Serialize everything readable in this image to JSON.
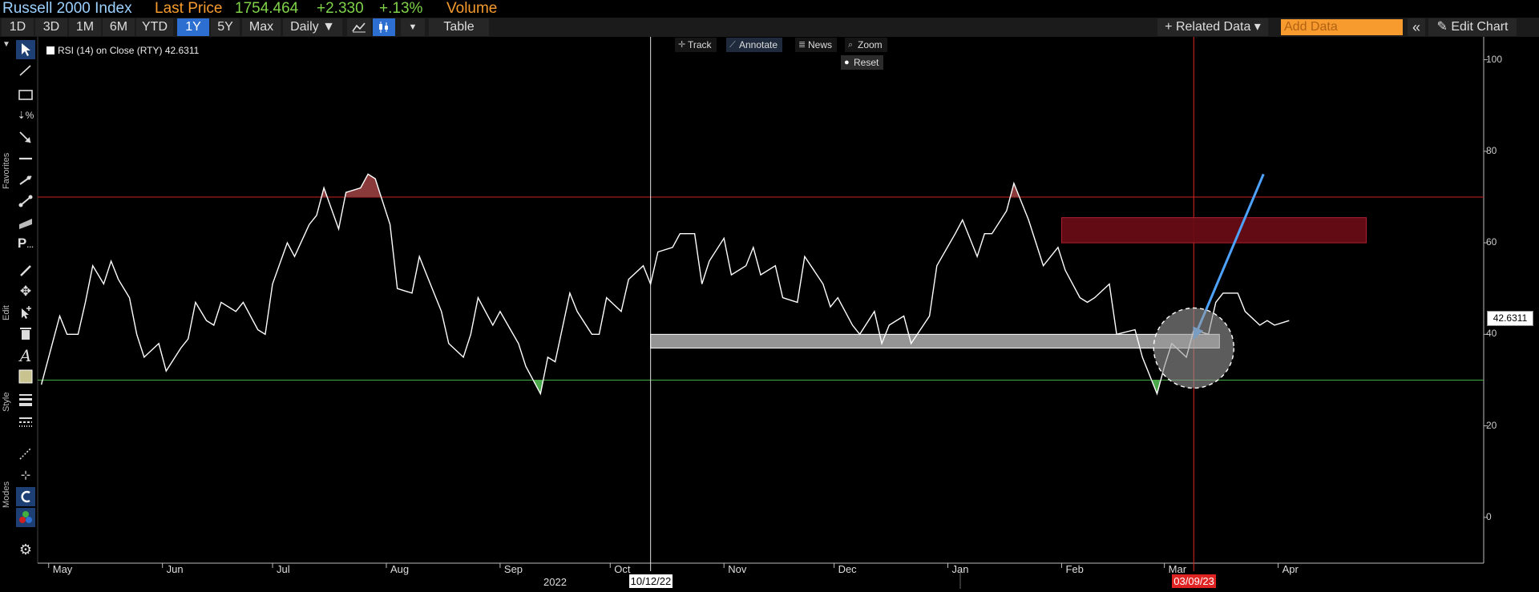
{
  "header": {
    "index_name": "Russell 2000 Index",
    "last_price_label": "Last Price",
    "last_price": "1754.464",
    "change": "+2.330",
    "change_pct": "+.13%",
    "volume_label": "Volume",
    "colors": {
      "index_name": "#9bd0ff",
      "label": "#f79b2e",
      "price": "#7fd34a"
    }
  },
  "toolbar": {
    "periods": [
      "1D",
      "3D",
      "1M",
      "6M",
      "YTD",
      "1Y",
      "5Y",
      "Max"
    ],
    "active_period": "1Y",
    "frequency": "Daily ▼",
    "table_label": "Table",
    "related_data": "+ Related Data ▾",
    "add_data_placeholder": "Add Data",
    "collapse": "«",
    "edit_chart": "✎ Edit Chart",
    "line_icon": "line-chart-icon",
    "candle_icon": "candlestick-icon",
    "more_icon": "dropdown-arrow-icon"
  },
  "side_panel": {
    "sections": [
      "Favorites",
      "Edit",
      "Style",
      "Modes"
    ],
    "tools": [
      "pointer-icon",
      "line-draw-icon",
      "rectangle-icon",
      "percent-measure-icon",
      "arrow-icon",
      "horizontal-line-icon",
      "trend-line-icon",
      "segment-icon",
      "channel-icon",
      "pitchfork-icon",
      "pen-icon",
      "move-icon",
      "add-pointer-icon",
      "trash-icon",
      "text-icon",
      "fill-color-icon",
      "line-weight-icon",
      "line-style-icon",
      "crosshair-mode-icon",
      "magnet-mode-icon",
      "snap-icon",
      "color-mode-icon",
      "settings-icon"
    ]
  },
  "chart_controls": {
    "track": "Track",
    "annotate": "Annotate",
    "news": "News",
    "zoom": "Zoom",
    "reset": "Reset"
  },
  "legend": {
    "label": "RSI (14)  on Close (RTY) 42.6311"
  },
  "crosshair_labels": {
    "left_date": "10/12/22",
    "right_date": "03/09/23"
  },
  "last_value_label": "42.6311",
  "chart_data": {
    "type": "line",
    "series": [
      {
        "name": "RSI (14) on Close (RTY)",
        "color": "#ffffff",
        "x": [
          "2022-04-29",
          "2022-05-02",
          "2022-05-04",
          "2022-05-06",
          "2022-05-09",
          "2022-05-11",
          "2022-05-13",
          "2022-05-16",
          "2022-05-18",
          "2022-05-20",
          "2022-05-23",
          "2022-05-25",
          "2022-05-27",
          "2022-05-31",
          "2022-06-02",
          "2022-06-06",
          "2022-06-08",
          "2022-06-10",
          "2022-06-13",
          "2022-06-15",
          "2022-06-17",
          "2022-06-21",
          "2022-06-23",
          "2022-06-27",
          "2022-06-29",
          "2022-07-01",
          "2022-07-05",
          "2022-07-07",
          "2022-07-11",
          "2022-07-13",
          "2022-07-15",
          "2022-07-19",
          "2022-07-21",
          "2022-07-25",
          "2022-07-27",
          "2022-07-29",
          "2022-08-02",
          "2022-08-04",
          "2022-08-08",
          "2022-08-10",
          "2022-08-12",
          "2022-08-16",
          "2022-08-18",
          "2022-08-22",
          "2022-08-24",
          "2022-08-26",
          "2022-08-30",
          "2022-09-01",
          "2022-09-06",
          "2022-09-08",
          "2022-09-12",
          "2022-09-14",
          "2022-09-16",
          "2022-09-20",
          "2022-09-22",
          "2022-09-26",
          "2022-09-28",
          "2022-09-30",
          "2022-10-04",
          "2022-10-06",
          "2022-10-10",
          "2022-10-12",
          "2022-10-14",
          "2022-10-18",
          "2022-10-20",
          "2022-10-24",
          "2022-10-26",
          "2022-10-28",
          "2022-11-01",
          "2022-11-03",
          "2022-11-07",
          "2022-11-09",
          "2022-11-11",
          "2022-11-15",
          "2022-11-17",
          "2022-11-21",
          "2022-11-23",
          "2022-11-28",
          "2022-11-30",
          "2022-12-02",
          "2022-12-06",
          "2022-12-08",
          "2022-12-12",
          "2022-12-14",
          "2022-12-16",
          "2022-12-20",
          "2022-12-22",
          "2022-12-27",
          "2022-12-29",
          "2023-01-03",
          "2023-01-05",
          "2023-01-09",
          "2023-01-11",
          "2023-01-13",
          "2023-01-17",
          "2023-01-19",
          "2023-01-23",
          "2023-01-25",
          "2023-01-27",
          "2023-01-31",
          "2023-02-02",
          "2023-02-06",
          "2023-02-08",
          "2023-02-10",
          "2023-02-14",
          "2023-02-16",
          "2023-02-21",
          "2023-02-23",
          "2023-02-27",
          "2023-03-01",
          "2023-03-03",
          "2023-03-07",
          "2023-03-09",
          "2023-03-13",
          "2023-03-15",
          "2023-03-17",
          "2023-03-21",
          "2023-03-23",
          "2023-03-27",
          "2023-03-29",
          "2023-03-31",
          "2023-04-04"
        ],
        "y": [
          29,
          38,
          44,
          40,
          40,
          47,
          55,
          51,
          56,
          52,
          48,
          40,
          35,
          38,
          32,
          37,
          39,
          47,
          43,
          42,
          47,
          45,
          47,
          41,
          40,
          51,
          60,
          57,
          64,
          66,
          72,
          63,
          71,
          72,
          75,
          74,
          64,
          50,
          49,
          57,
          53,
          45,
          38,
          35,
          40,
          48,
          42,
          45,
          38,
          33,
          27,
          35,
          34,
          49,
          45,
          40,
          40,
          48,
          45,
          52,
          55,
          51,
          58,
          59,
          62,
          62,
          51,
          56,
          61,
          53,
          55,
          59,
          53,
          55,
          48,
          47,
          57,
          51,
          46,
          48,
          42,
          40,
          45,
          38,
          42,
          44,
          38,
          44,
          55,
          62,
          65,
          57,
          62,
          62,
          67,
          73,
          65,
          60,
          55,
          59,
          54,
          48,
          47,
          48,
          51,
          40,
          41,
          35,
          27,
          33,
          38,
          35,
          41,
          40,
          47,
          49,
          49,
          45,
          42,
          43,
          42,
          43
        ],
        "overbought_segment": {
          "from": "2022-07-25",
          "to": "2022-08-02"
        },
        "oversold_segments": [
          {
            "from": "2022-09-12",
            "to": "2022-09-12"
          },
          {
            "from": "2023-02-27",
            "to": "2023-02-27"
          }
        ]
      }
    ],
    "reference_lines": [
      {
        "value": 70,
        "color": "#d12020"
      },
      {
        "value": 30,
        "color": "#3fae3f"
      }
    ],
    "crosshairs": [
      {
        "date": "2022-10-12",
        "color": "#e0e0e0"
      },
      {
        "date": "2023-03-09",
        "color": "#e02424"
      }
    ],
    "annotations": [
      {
        "kind": "rectangle",
        "from": "2022-10-12",
        "to": "2023-03-16",
        "y1": 37,
        "y2": 40,
        "fill": "#cfcfcf"
      },
      {
        "kind": "rectangle",
        "from": "2023-02-01",
        "to": "2023-04-25",
        "y1": 60,
        "y2": 65.5,
        "fill": "#6a0c16"
      },
      {
        "kind": "arrow",
        "from_date": "2023-03-28",
        "from_y": 75,
        "to_date": "2023-03-09",
        "to_y": 39,
        "color": "#4ea3ff"
      },
      {
        "kind": "ellipse",
        "center_date": "2023-03-09",
        "center_y": 37,
        "fill": "#9a9a9a"
      }
    ],
    "xlabel": "",
    "ylabel": "",
    "ylim": [
      -10,
      105
    ],
    "yticks": [
      0,
      20,
      40,
      60,
      80,
      100
    ],
    "xtick_labels": [
      "May",
      "Jun",
      "Jul",
      "Aug",
      "Sep",
      "Oct",
      "Nov",
      "Dec",
      "Jan",
      "Feb",
      "Mar",
      "Apr"
    ],
    "xtick_dates": [
      "2022-05-01",
      "2022-06-01",
      "2022-07-01",
      "2022-08-01",
      "2022-09-01",
      "2022-10-01",
      "2022-11-01",
      "2022-12-01",
      "2023-01-01",
      "2023-02-01",
      "2023-03-01",
      "2023-04-01"
    ],
    "year_label": "2022",
    "year_label_date": "2022-09-15",
    "xlim": [
      "2022-04-28",
      "2023-05-27"
    ],
    "grid": false,
    "legend": "top-left"
  }
}
